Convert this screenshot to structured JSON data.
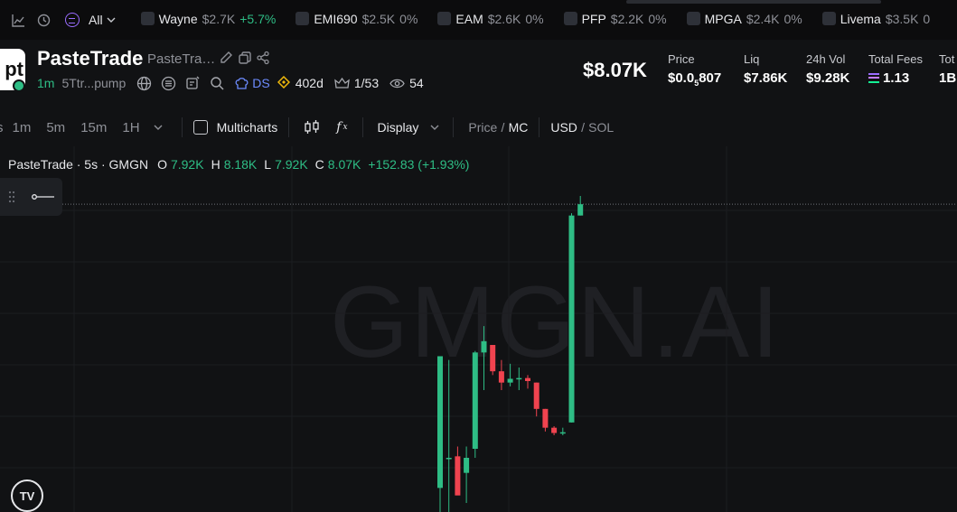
{
  "ticker": {
    "filter_label": "All",
    "items": [
      {
        "name": "Wayne",
        "mc": "$2.7K",
        "change": "+5.7%",
        "up": true
      },
      {
        "name": "EMI690",
        "mc": "$2.5K",
        "change": "0%",
        "up": false
      },
      {
        "name": "EAM",
        "mc": "$2.6K",
        "change": "0%",
        "up": false
      },
      {
        "name": "PFP",
        "mc": "$2.2K",
        "change": "0%",
        "up": false
      },
      {
        "name": "MPGA",
        "mc": "$2.4K",
        "change": "0%",
        "up": false
      },
      {
        "name": "Livema",
        "mc": "$3.5K",
        "change": "0",
        "up": false
      }
    ]
  },
  "token": {
    "logo_text": "pt",
    "name": "PasteTrade",
    "symbol_truncated": "PasteTra…",
    "age": "1m",
    "address": "5Ttr...pump",
    "ds_label": "DS",
    "days": "402d",
    "ratio": "1/53",
    "views": "54"
  },
  "stats": {
    "market_cap": "$8.07K",
    "price_label": "Price",
    "price_prefix": "$0.0",
    "price_sub": "5",
    "price_suffix": "807",
    "liq_label": "Liq",
    "liq_value": "$7.86K",
    "vol_label": "24h Vol",
    "vol_value": "$9.28K",
    "fees_label": "Total Fees",
    "fees_value": "1.13",
    "cut_label": "Tot",
    "cut_value": "1B"
  },
  "toolbar": {
    "resolutions": [
      "1m",
      "5m",
      "15m",
      "1H"
    ],
    "multicharts": "Multicharts",
    "fx": "f",
    "fx_sub": "x",
    "display": "Display",
    "price": "Price",
    "slash1": "/",
    "mc": "MC",
    "usd": "USD",
    "slash2": "/",
    "sol": "SOL"
  },
  "chart": {
    "legend_title": "PasteTrade · 5s · GMGN",
    "o_label": "O",
    "o_value": "7.92K",
    "h_label": "H",
    "h_value": "8.18K",
    "l_label": "L",
    "l_value": "7.92K",
    "c_label": "C",
    "c_value": "8.07K",
    "change": "+152.83 (+1.93%)",
    "watermark": "GMGN.AI",
    "tv_logo": "TV",
    "colors": {
      "up": "#2ebd85",
      "down": "#f0434f",
      "grid": "#1c1d21",
      "price_line": "#6e7178"
    },
    "last_value": 8.07
  },
  "chart_data": {
    "type": "candlestick",
    "x": [
      1,
      2,
      3,
      4,
      5,
      6,
      7,
      8,
      9,
      10,
      11,
      12,
      13,
      14,
      15,
      16,
      17
    ],
    "series": [
      {
        "open": [
          4.3,
          4.7,
          4.72,
          4.5,
          4.82,
          6.1,
          6.2,
          5.85,
          5.7,
          5.75,
          5.76,
          5.7,
          5.35,
          5.1,
          5.03,
          5.17,
          7.92
        ],
        "high": [
          6.05,
          6.0,
          4.85,
          4.85,
          6.12,
          6.45,
          6.2,
          6.0,
          5.95,
          5.9,
          5.8,
          5.7,
          5.35,
          5.12,
          5.1,
          7.95,
          8.18
        ],
        "low": [
          3.9,
          3.9,
          4.4,
          4.1,
          4.7,
          5.6,
          5.8,
          5.6,
          5.65,
          5.6,
          5.62,
          5.25,
          5.05,
          5.0,
          5.0,
          5.17,
          7.92
        ],
        "close": [
          6.05,
          4.7,
          4.2,
          4.7,
          6.1,
          6.25,
          5.85,
          5.7,
          5.75,
          5.76,
          5.72,
          5.35,
          5.1,
          5.03,
          5.04,
          7.92,
          8.07
        ]
      }
    ],
    "ylim": [
      3.8,
      8.6
    ]
  }
}
